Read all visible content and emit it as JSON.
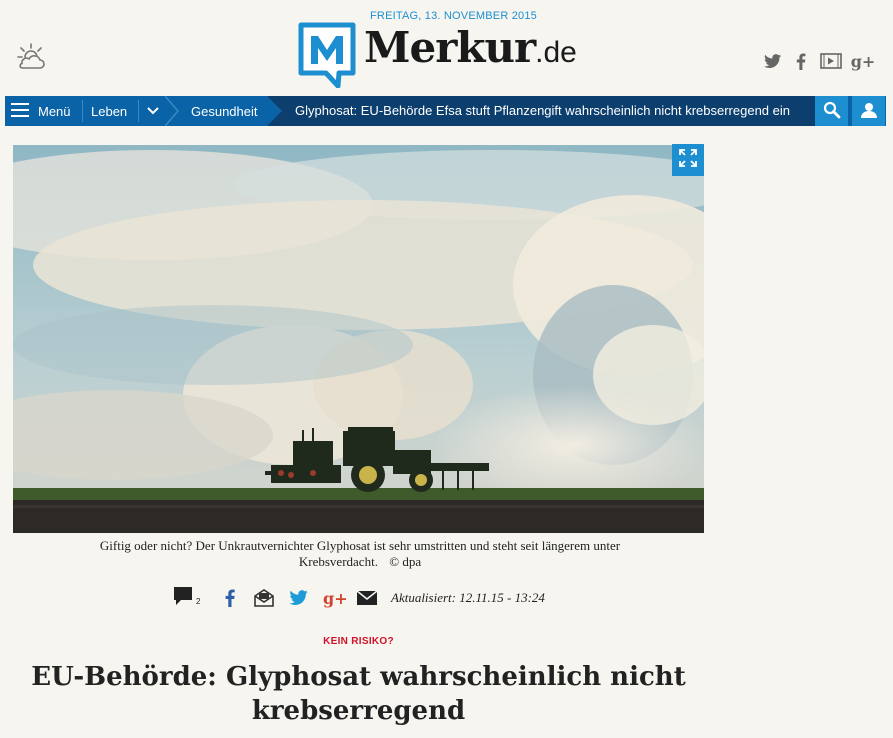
{
  "header": {
    "date": "FREITAG, 13. NOVEMBER 2015",
    "logo_name": "Merkur",
    "logo_tld": ".de",
    "weather_icon": "weather-cloud-sun-icon",
    "social": [
      "twitter-icon",
      "facebook-icon",
      "video-icon",
      "google-plus-icon"
    ]
  },
  "nav": {
    "menu_label": "Menü",
    "crumb_1": "Leben",
    "crumb_2": "Gesundheit",
    "headline": "Glyphosat: EU-Behörde Efsa stuft Pflanzengift wahrscheinlich nicht krebserregend ein",
    "icons": [
      "hamburger-icon",
      "chevron-down-icon",
      "search-icon",
      "user-icon"
    ]
  },
  "article": {
    "caption": "Giftig oder nicht? Der Unkrautvernichter Glyphosat ist sehr umstritten und steht seit längerem unter Krebsverdacht.",
    "credit": "© dpa",
    "comment_count": "2",
    "updated": "Aktualisiert: 12.11.15 - 13:24",
    "kicker": "KEIN RISIKO?",
    "title": "EU-Behörde: Glyphosat wahrscheinlich nicht krebserregend"
  },
  "colors": {
    "accent": "#1d8fd1",
    "nav_bg": "#0a63a6",
    "headline_strip": "#0c3f6e",
    "kicker": "#d0122a",
    "background": "#f6f5f0"
  }
}
